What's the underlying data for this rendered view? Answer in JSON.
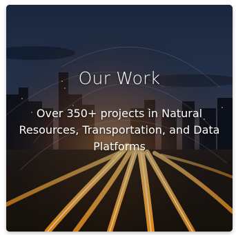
{
  "card": {
    "title": "Our Work",
    "description": "Over 350+ projects in Natural Resources, Transportation, and Data Platforms",
    "background": "city-night-highway-image"
  }
}
